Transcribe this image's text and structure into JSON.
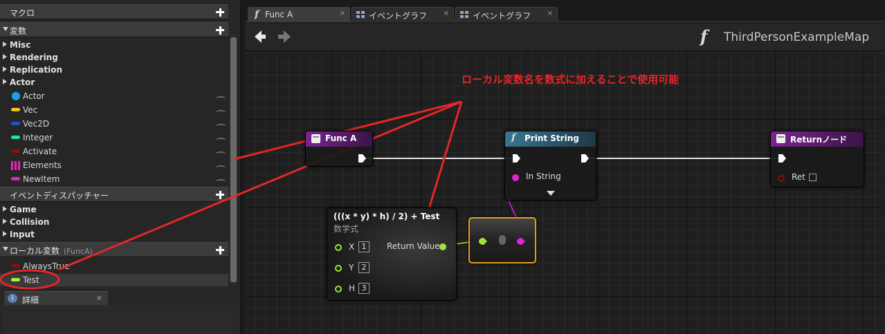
{
  "left_panel": {
    "sections": {
      "macro": "マクロ",
      "variables": "変数",
      "dispatchers": "イベントディスパッチャー",
      "local_vars": "ローカル変数",
      "local_vars_scope": "(FuncA)"
    },
    "var_categories": [
      "Misc",
      "Rendering",
      "Replication",
      "Actor"
    ],
    "variables": [
      {
        "label": "Actor",
        "color": "#1aa3e8"
      },
      {
        "label": "Vec",
        "color": "#f5c21a"
      },
      {
        "label": "Vec2D",
        "color": "#1a56c7"
      },
      {
        "label": "Integer",
        "color": "#1ee3b0"
      },
      {
        "label": "Activate",
        "color": "#8a0f0f"
      },
      {
        "label": "Elements",
        "color": "#e823c0"
      },
      {
        "label": "NewItem",
        "color": "#e323d2"
      }
    ],
    "dispatcher_categories": [
      "Game",
      "Collision",
      "Input"
    ],
    "local_variables": [
      {
        "label": "AlwaysTrue",
        "color": "#8a0f0f"
      },
      {
        "label": "Test",
        "color": "#a8f03a"
      }
    ],
    "details_tab": {
      "label": "詳細",
      "close": "×"
    }
  },
  "tabs": [
    {
      "label": "Func A",
      "icon": "function-icon",
      "active": true,
      "close": "×"
    },
    {
      "label": "イベントグラフ",
      "icon": "graph-icon",
      "active": false,
      "close": "×"
    },
    {
      "label": "イベントグラフ",
      "icon": "graph-icon",
      "active": false,
      "close": "×"
    }
  ],
  "nav": {
    "map_title": "ThirdPersonExampleMap",
    "func_glyph": "f"
  },
  "annotation": "ローカル変数名を数式に加えることで使用可能",
  "nodes": {
    "func_a": {
      "title": "Func A",
      "color": "#6d2181"
    },
    "print_string": {
      "title": "Print String",
      "color": "#2e5a6e",
      "in_string": "In String",
      "glyph": "f"
    },
    "return_node": {
      "title": "Returnノード",
      "color": "#6d2181",
      "ret": "Ret"
    },
    "math_expr": {
      "title_prefix": "(((x * y) * h) / 2) + ",
      "title_highlight": "Test",
      "subtitle": "数学式",
      "inputs": [
        {
          "label": "X",
          "value": "1"
        },
        {
          "label": "Y",
          "value": "2"
        },
        {
          "label": "H",
          "value": "3"
        }
      ],
      "output": "Return Value"
    }
  }
}
